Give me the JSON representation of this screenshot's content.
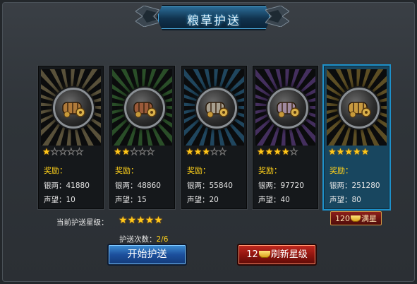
{
  "title": "粮草护送",
  "cards": [
    {
      "stars": 1,
      "reward_label": "奖励：",
      "silver": "银两：41880",
      "fame": "声望：10",
      "ray_color": "#b8a670",
      "medallion_tint": "#b07a3a"
    },
    {
      "stars": 2,
      "reward_label": "奖励：",
      "silver": "银两：48860",
      "fame": "声望：15",
      "ray_color": "#4fa04a",
      "medallion_tint": "#9b5a3a"
    },
    {
      "stars": 3,
      "reward_label": "奖励：",
      "silver": "银两：55840",
      "fame": "声望：20",
      "ray_color": "#3a8fc0",
      "medallion_tint": "#a8a090"
    },
    {
      "stars": 4,
      "reward_label": "奖励：",
      "silver": "银两：97720",
      "fame": "声望：40",
      "ray_color": "#8a5cc0",
      "medallion_tint": "#a08aa0"
    },
    {
      "stars": 5,
      "reward_label": "奖励：",
      "silver": "银两：251280",
      "fame": "声望：80",
      "ray_color": "#c0a040",
      "medallion_tint": "#c89a40",
      "selected": true
    }
  ],
  "max_star_button": {
    "cost": "120",
    "label": "满星"
  },
  "current_level": {
    "label": "当前护送星级：",
    "stars": 5
  },
  "escort_count": {
    "label": "护送次数：",
    "value": "2/6"
  },
  "start_button": {
    "label": "开始护送"
  },
  "refresh_button": {
    "cost": "12",
    "label": "刷新星级"
  },
  "colors": {
    "gold": "#ffd11a",
    "selected_border": "#1e90c9",
    "star": "#ffc81a"
  },
  "icons": [
    "cargo-icon",
    "star-icon",
    "gold-ingot-icon"
  ]
}
